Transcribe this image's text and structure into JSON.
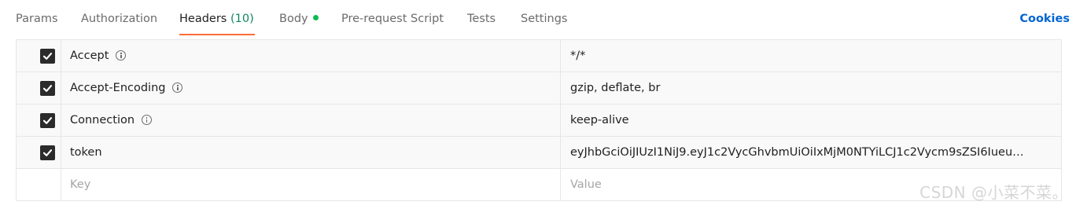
{
  "tabs": [
    {
      "label": "Params",
      "active": false
    },
    {
      "label": "Authorization",
      "active": false
    },
    {
      "label": "Headers",
      "count": "(10)",
      "active": true
    },
    {
      "label": "Body",
      "has_dot": true,
      "active": false
    },
    {
      "label": "Pre-request Script",
      "active": false
    },
    {
      "label": "Tests",
      "active": false
    },
    {
      "label": "Settings",
      "active": false
    }
  ],
  "cookies_label": "Cookies",
  "headers": [
    {
      "key": "Accept",
      "value": "*/*",
      "checked": true,
      "info": true
    },
    {
      "key": "Accept-Encoding",
      "value": "gzip, deflate, br",
      "checked": true,
      "info": true
    },
    {
      "key": "Connection",
      "value": "keep-alive",
      "checked": true,
      "info": true
    },
    {
      "key": "token",
      "value": "eyJhbGciOiJIUzI1NiJ9.eyJ1c2VycGhvbmUiOiIxMjM0NTYiLCJ1c2Vycm9sZSI6Iueu…",
      "checked": true,
      "info": false
    }
  ],
  "new_row": {
    "key_placeholder": "Key",
    "value_placeholder": "Value"
  },
  "watermark": "CSDN @小菜不菜。",
  "colors": {
    "accent_underline": "#ff6c37",
    "count": "#0f8a5f",
    "body_dot": "#0cbb52",
    "cookies_link": "#0265d2"
  }
}
